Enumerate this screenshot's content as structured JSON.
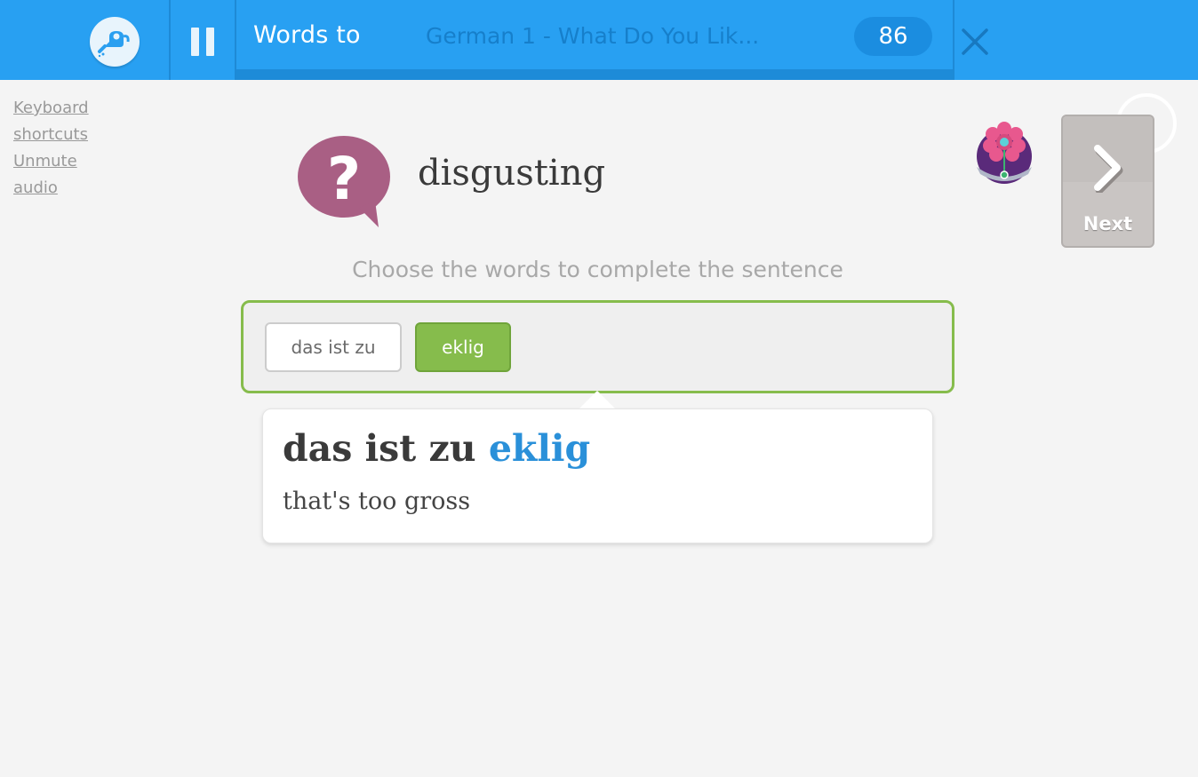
{
  "header": {
    "mode_title": "Words to",
    "course_title": "German 1 - What Do You Lik...",
    "score": "86",
    "progress_fraction": 0.0
  },
  "sidebar_links": [
    "Keyboard",
    "shortcuts",
    "Unmute",
    "audio"
  ],
  "prompt": {
    "word": "disgusting",
    "icon": "question-bubble-icon"
  },
  "next_button": {
    "label": "Next",
    "icon": "chevron-right-icon"
  },
  "instruction": "Choose the words to complete the sentence",
  "answer": {
    "fixed_words": "das ist zu",
    "selected_word": "eklig"
  },
  "tooltip": {
    "phrase_prefix": "das ist zu",
    "phrase_highlight": "eklig",
    "translation": "that's too gross"
  },
  "colors": {
    "topbar": "#28a0f2",
    "accent_green": "#86bc4c",
    "highlight_blue": "#2a90d9",
    "bubble_purple": "#a95f84"
  }
}
